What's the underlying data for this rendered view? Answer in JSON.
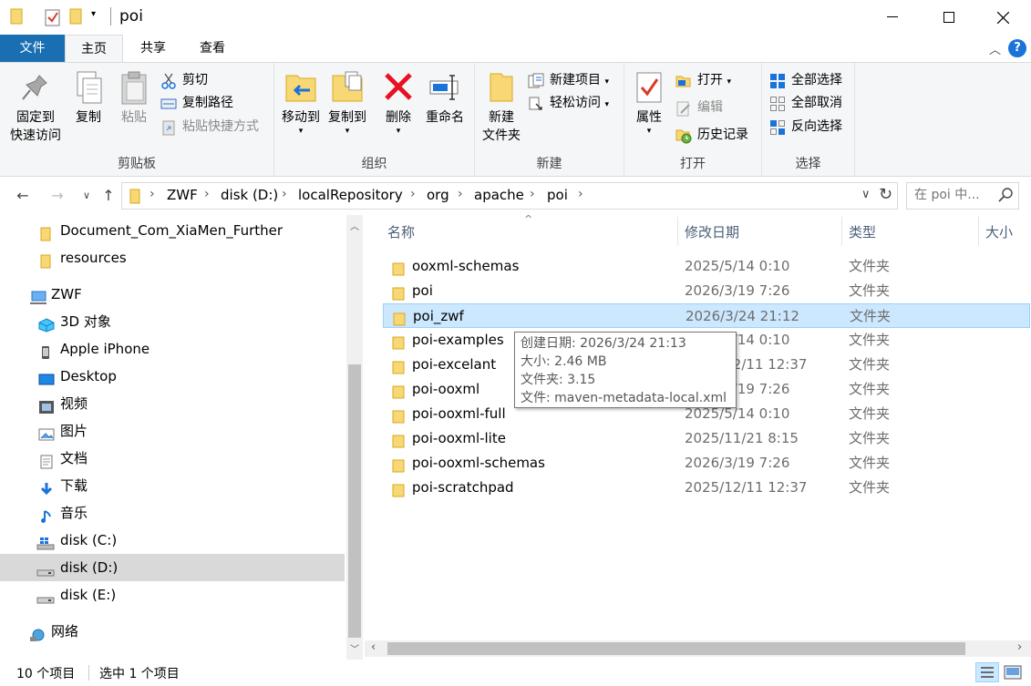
{
  "window": {
    "title": "poi",
    "minimize_glyph": "—",
    "maximize_glyph": "☐",
    "close_glyph": "✕"
  },
  "ribbon_tabs": [
    "文件",
    "主页",
    "共享",
    "查看"
  ],
  "ribbon": {
    "clipboard": {
      "group_label": "剪贴板",
      "pin_line1": "固定到",
      "pin_line2": "快速访问",
      "copy": "复制",
      "paste": "粘贴",
      "cut": "剪切",
      "copy_path": "复制路径",
      "paste_shortcut": "粘贴快捷方式"
    },
    "organize": {
      "group_label": "组织",
      "move_to": "移动到",
      "copy_to": "复制到",
      "delete": "删除",
      "rename": "重命名"
    },
    "new": {
      "group_label": "新建",
      "new_folder_line1": "新建",
      "new_folder_line2": "文件夹",
      "new_item": "新建项目",
      "easy_access": "轻松访问"
    },
    "open": {
      "group_label": "打开",
      "properties": "属性",
      "open": "打开",
      "edit": "编辑",
      "history": "历史记录"
    },
    "select": {
      "group_label": "选择",
      "select_all": "全部选择",
      "select_none": "全部取消",
      "invert": "反向选择"
    }
  },
  "address": {
    "crumbs": [
      "ZWF",
      "disk (D:)",
      "localRepository",
      "org",
      "apache",
      "poi"
    ],
    "search_placeholder": "在 poi 中..."
  },
  "nav_pane": {
    "items": [
      {
        "label": "Document_Com_XiaMen_Further",
        "icon": "folder-icon"
      },
      {
        "label": "resources",
        "icon": "folder-icon"
      },
      {
        "label": "ZWF",
        "icon": "computer-icon"
      },
      {
        "label": "3D 对象",
        "icon": "3d-objects-icon"
      },
      {
        "label": "Apple iPhone",
        "icon": "phone-icon"
      },
      {
        "label": "Desktop",
        "icon": "desktop-icon"
      },
      {
        "label": "视频",
        "icon": "video-icon"
      },
      {
        "label": "图片",
        "icon": "pictures-icon"
      },
      {
        "label": "文档",
        "icon": "documents-icon"
      },
      {
        "label": "下载",
        "icon": "download-icon"
      },
      {
        "label": "音乐",
        "icon": "music-icon"
      },
      {
        "label": "disk (C:)",
        "icon": "windows-drive-icon"
      },
      {
        "label": "disk (D:)",
        "icon": "drive-icon"
      },
      {
        "label": "disk (E:)",
        "icon": "drive-icon"
      },
      {
        "label": "网络",
        "icon": "network-icon"
      }
    ],
    "selected": "disk (D:)"
  },
  "file_list": {
    "columns": [
      "名称",
      "修改日期",
      "类型",
      "大小"
    ],
    "rows": [
      {
        "name": "ooxml-schemas",
        "date": "2025/5/14 0:10",
        "type": "文件夹"
      },
      {
        "name": "poi",
        "date": "2026/3/19 7:26",
        "type": "文件夹"
      },
      {
        "name": "poi_zwf",
        "date": "2026/3/24 21:12",
        "type": "文件夹"
      },
      {
        "name": "poi-examples",
        "date": "2025/5/14 0:10",
        "type": "文件夹"
      },
      {
        "name": "poi-excelant",
        "date": "2025/12/11 12:37",
        "type": "文件夹"
      },
      {
        "name": "poi-ooxml",
        "date": "2026/3/19 7:26",
        "type": "文件夹"
      },
      {
        "name": "poi-ooxml-full",
        "date": "2025/5/14 0:10",
        "type": "文件夹"
      },
      {
        "name": "poi-ooxml-lite",
        "date": "2025/11/21 8:15",
        "type": "文件夹"
      },
      {
        "name": "poi-ooxml-schemas",
        "date": "2026/3/19 7:26",
        "type": "文件夹"
      },
      {
        "name": "poi-scratchpad",
        "date": "2025/12/11 12:37",
        "type": "文件夹"
      }
    ],
    "selected": "poi_zwf"
  },
  "tooltip": {
    "created": "创建日期: 2026/3/24 21:13",
    "size": "大小: 2.46 MB",
    "folders": "文件夹: 3.15",
    "files": "文件: maven-metadata-local.xml"
  },
  "status": {
    "count": "10 个项目",
    "selection": "选中 1 个项目"
  },
  "colors": {
    "file_tab": "#1a6fb3",
    "selection": "#cce8ff",
    "folder_yellow": "#f8d775",
    "accent_blue": "#1a73d9"
  }
}
